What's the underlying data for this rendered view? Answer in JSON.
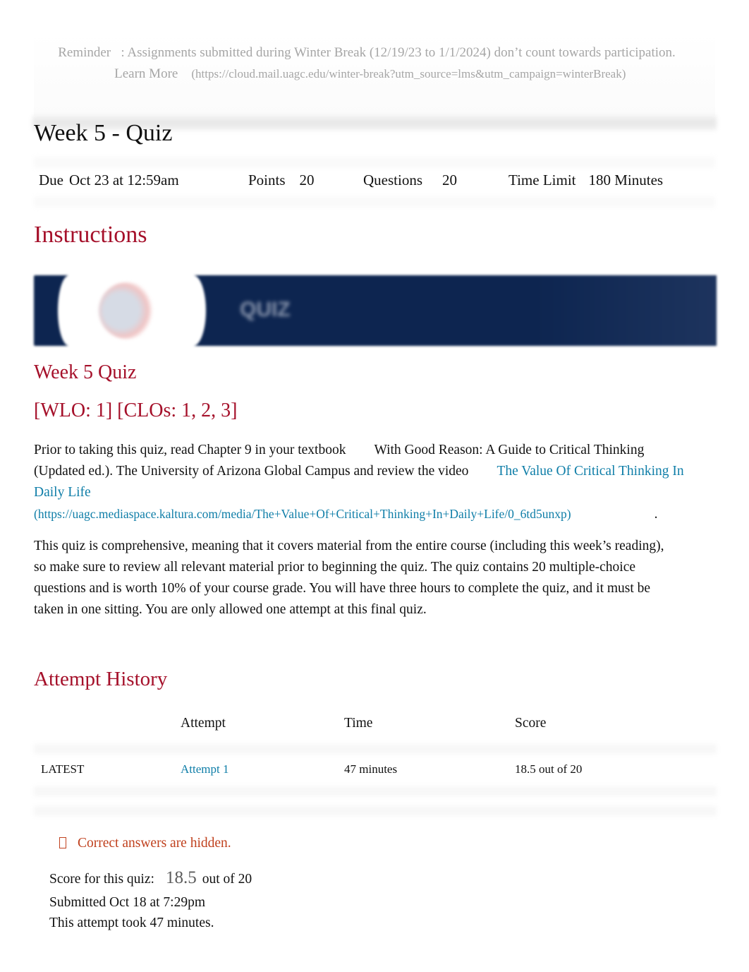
{
  "reminder": {
    "label": "Reminder",
    "text": ": Assignments submitted during Winter Break (12/19/23 to 1/1/2024) don’t count towards participation.",
    "learn_more": "Learn More",
    "learn_more_url": "(https://cloud.mail.uagc.edu/winter-break?utm_source=lms&utm_campaign=winterBreak)"
  },
  "quiz": {
    "title": "Week 5 - Quiz",
    "meta": {
      "due_label": "Due",
      "due_value": "Oct 23 at 12:59am",
      "points_label": "Points",
      "points_value": "20",
      "questions_label": "Questions",
      "questions_value": "20",
      "time_limit_label": "Time Limit",
      "time_limit_value": "180 Minutes"
    }
  },
  "instructions": {
    "heading": "Instructions",
    "banner_text": "QUIZ",
    "subheading": "Week 5 Quiz",
    "outcomes": "[WLO: 1] [CLOs: 1, 2, 3]",
    "para1_a": "Prior to taking this quiz, read Chapter 9 in your textbook",
    "para1_book": "With Good Reason: A Guide to Critical Thinking (Updated ed.). The University of Arizona Global Campus and review the video",
    "video_link": "The Value Of Critical Thinking In Daily Life",
    "video_url": "(https://uagc.mediaspace.kaltura.com/media/The+Value+Of+Critical+Thinking+In+Daily+Life/0_6td5unxp)",
    "para1_end": ".",
    "para2": "This quiz is comprehensive, meaning that it covers material from the entire course (including this week’s reading), so make sure to review all relevant material prior to beginning the quiz. The quiz contains 20 multiple-choice questions and is worth 10% of your course grade. You will have three hours to complete the quiz, and it must be taken in one sitting. You are only allowed one attempt at this final quiz."
  },
  "attempt_history": {
    "heading": "Attempt History",
    "columns": [
      "",
      "Attempt",
      "Time",
      "Score"
    ],
    "rows": [
      {
        "tag": "LATEST",
        "attempt": "Attempt 1",
        "time": "47 minutes",
        "score": "18.5 out of 20"
      }
    ]
  },
  "result": {
    "hidden_note": "Correct answers are hidden.",
    "score_label": "Score for this quiz:",
    "score_value": "18.5",
    "score_out_of": "out of 20",
    "submitted": "Submitted Oct 18 at 7:29pm",
    "took": "This attempt took 47 minutes."
  }
}
